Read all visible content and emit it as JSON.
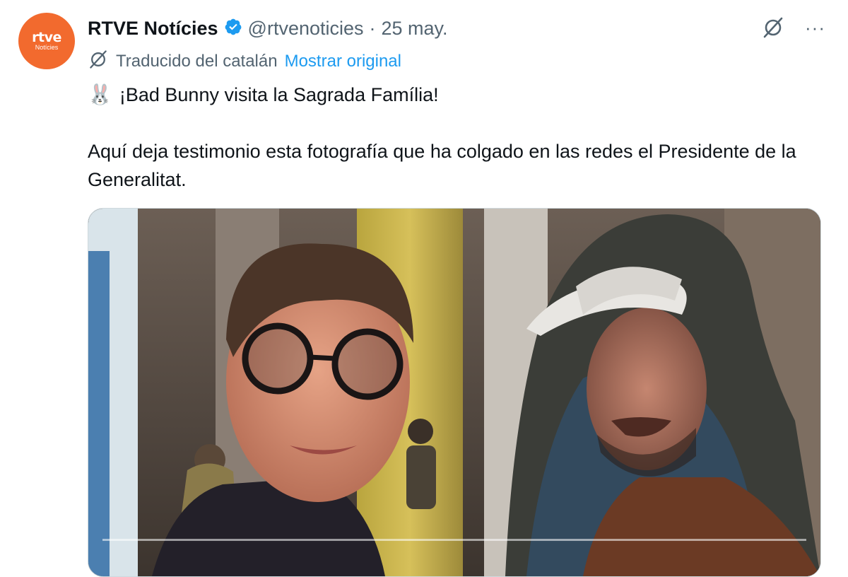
{
  "tweet": {
    "avatar": {
      "logo_text": "rtve",
      "logo_sub": "Notícies"
    },
    "author_name": "RTVE Notícies",
    "handle": "@rtvenoticies",
    "separator": "·",
    "date": "25 may.",
    "more_label": "···",
    "translation": {
      "label": "Traducido del catalán",
      "show_original": "Mostrar original"
    },
    "emoji": "🐰",
    "text_line1": "¡Bad Bunny visita la Sagrada Família!",
    "text_para2": "Aquí deja testimonio esta fotografía que ha colgado en las redes el Presidente de la Generalitat.",
    "media": {
      "type": "video",
      "progress": 0.0
    }
  },
  "colors": {
    "brand_orange": "#f26a2e",
    "link_blue": "#1d9bf0",
    "secondary_text": "#536471",
    "verified_blue": "#1d9bf0"
  },
  "icons": [
    "verified-badge-icon",
    "grok-icon",
    "more-icon",
    "translate-icon",
    "rabbit-emoji-icon"
  ]
}
